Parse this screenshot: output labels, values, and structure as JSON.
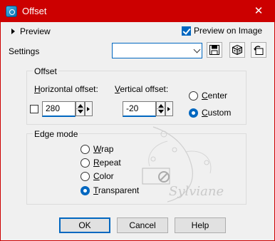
{
  "window": {
    "title": "Offset",
    "close_glyph": "✕"
  },
  "preview": {
    "expander_label": "Preview",
    "preview_on_image_label": "Preview on Image",
    "preview_on_image_checked": true
  },
  "settings": {
    "label": "Settings",
    "combo_value": ""
  },
  "offset_group": {
    "legend": "Offset",
    "horizontal_label_accel": "H",
    "horizontal_label_rest": "orizontal offset:",
    "vertical_label_accel": "V",
    "vertical_label_rest": "ertical offset:",
    "horizontal_value": "280",
    "vertical_value": "-20",
    "center_label_accel": "C",
    "center_label_rest": "enter",
    "custom_label_accel": "C",
    "custom_label_rest": "ustom",
    "selected": "Custom"
  },
  "edge_mode": {
    "legend": "Edge mode",
    "options": [
      {
        "accel": "W",
        "rest": "rap"
      },
      {
        "accel": "R",
        "rest": "epeat"
      },
      {
        "accel": "C",
        "rest": "olor"
      },
      {
        "accel": "T",
        "rest": "ransparent"
      }
    ],
    "selected": "Transparent"
  },
  "watermark": {
    "text": "Sylviane"
  },
  "buttons": {
    "ok": "OK",
    "cancel": "Cancel",
    "help": "Help"
  },
  "colors": {
    "titlebar": "#cc0000",
    "accent": "#0067c0"
  }
}
